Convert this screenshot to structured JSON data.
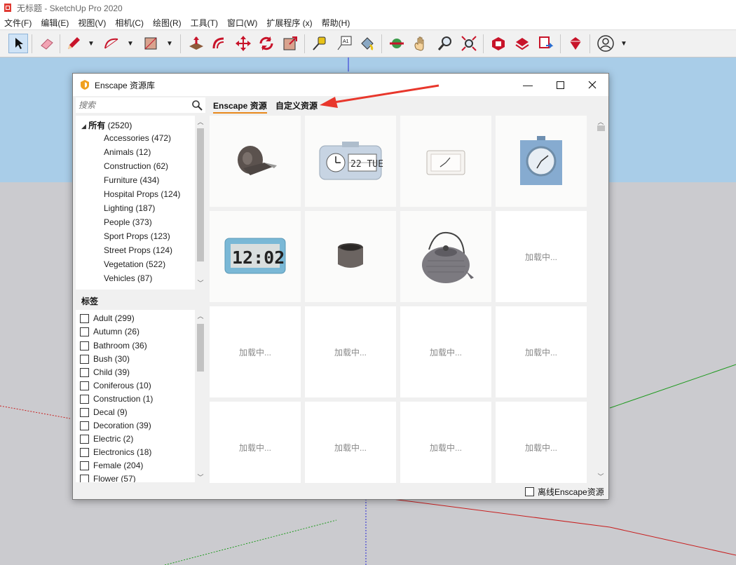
{
  "app": {
    "window_title": "无标题 - SketchUp Pro 2020",
    "menu": [
      "文件(F)",
      "编辑(E)",
      "视图(V)",
      "相机(C)",
      "绘图(R)",
      "工具(T)",
      "窗口(W)",
      "扩展程序 (x)",
      "帮助(H)"
    ]
  },
  "toolbar": {
    "icons": [
      "select-icon",
      "eraser-icon",
      "pencil-icon",
      "arc-icon",
      "rectangle-icon",
      "push-pull-icon",
      "offset-icon",
      "move-icon",
      "rotate-icon",
      "scale-icon",
      "tape-measure-icon",
      "text-label-icon",
      "paint-bucket-icon",
      "orbit-icon",
      "pan-icon",
      "zoom-icon",
      "zoom-extents-icon",
      "3d-warehouse-icon",
      "extension-warehouse-icon",
      "layout-send-icon",
      "extension-manager-icon",
      "user-account-icon"
    ],
    "text_tool_label": "A1"
  },
  "dialog": {
    "title": "Enscape 资源库",
    "search_placeholder": "搜索",
    "tabs": [
      "Enscape 资源",
      "自定义资源"
    ],
    "active_tab": "Enscape 资源",
    "category_root": {
      "label": "所有",
      "count": "(2520)"
    },
    "categories": [
      "Accessories (472)",
      "Animals (12)",
      "Construction (62)",
      "Furniture (434)",
      "Hospital Props (124)",
      "Lighting (187)",
      "People (373)",
      "Sport Props (123)",
      "Street Props (124)",
      "Vegetation (522)",
      "Vehicles (87)"
    ],
    "tags_heading": "标签",
    "tags": [
      "Adult (299)",
      "Autumn (26)",
      "Bathroom (36)",
      "Bush (30)",
      "Child (39)",
      "Coniferous (10)",
      "Construction (1)",
      "Decal (9)",
      "Decoration (39)",
      "Electric (2)",
      "Electronics (18)",
      "Female (204)",
      "Flower (57)"
    ],
    "assets": [
      {
        "kind": "tape-dispenser",
        "loaded": true
      },
      {
        "kind": "flip-clock",
        "loaded": true,
        "clock_text": "22 TUE"
      },
      {
        "kind": "white-desk-clock",
        "loaded": true
      },
      {
        "kind": "blue-square-clock",
        "loaded": true
      },
      {
        "kind": "digital-clock",
        "loaded": true,
        "clock_text": "12:02"
      },
      {
        "kind": "metal-cup",
        "loaded": true
      },
      {
        "kind": "teapot",
        "loaded": true
      },
      {
        "kind": "loading",
        "loaded": false
      },
      {
        "kind": "loading",
        "loaded": false
      },
      {
        "kind": "loading",
        "loaded": false
      },
      {
        "kind": "loading",
        "loaded": false
      },
      {
        "kind": "loading",
        "loaded": false
      },
      {
        "kind": "loading",
        "loaded": false
      },
      {
        "kind": "loading",
        "loaded": false
      },
      {
        "kind": "loading",
        "loaded": false
      },
      {
        "kind": "loading",
        "loaded": false
      }
    ],
    "loading_text": "加载中...",
    "offline_label": "离线Enscape资源",
    "offline_checked": false
  },
  "colors": {
    "tab_underline": "#e8891c",
    "annotation_arrow": "#e8372c",
    "sky": "#a9cde8",
    "ground": "#cbcbcf"
  }
}
